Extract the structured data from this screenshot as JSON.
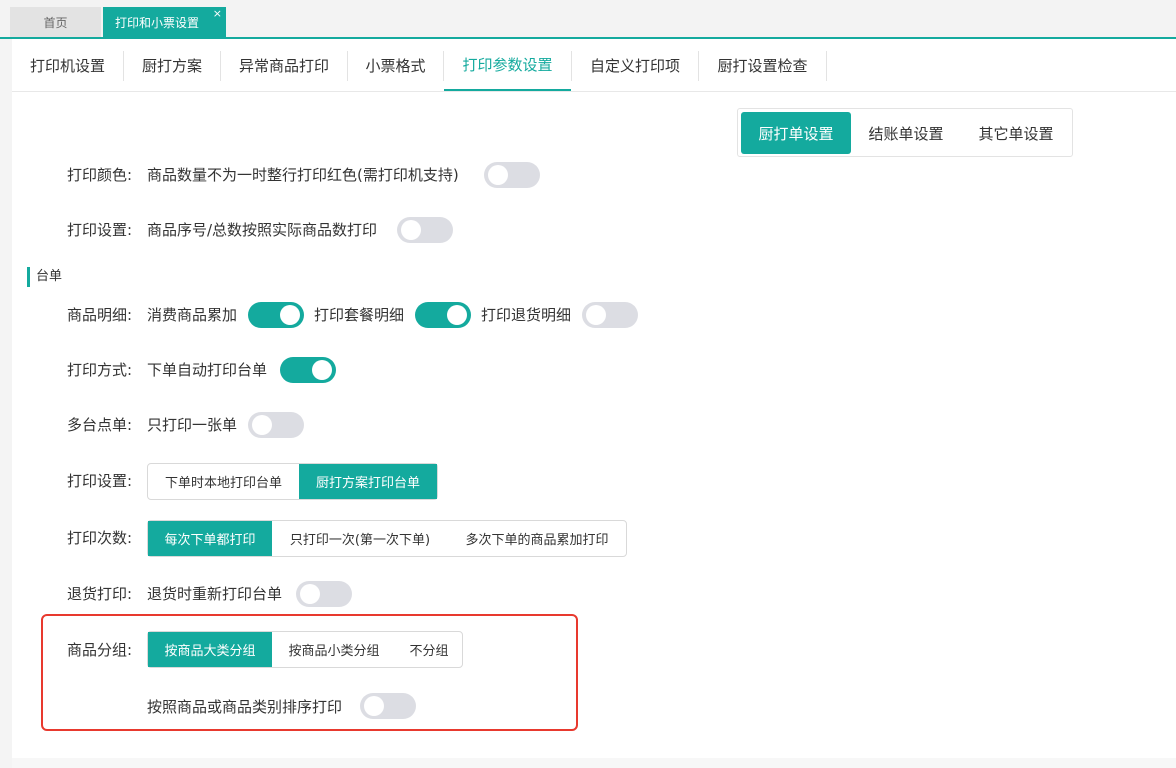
{
  "tabs": {
    "home": "首页",
    "active": "打印和小票设置",
    "close": "×"
  },
  "subnav": [
    "打印机设置",
    "厨打方案",
    "异常商品打印",
    "小票格式",
    "打印参数设置",
    "自定义打印项",
    "厨打设置检查"
  ],
  "subnav_active_index": 4,
  "order_types": {
    "items": [
      "厨打单设置",
      "结账单设置",
      "其它单设置"
    ],
    "active_index": 0
  },
  "settings": {
    "color_label": "打印颜色:",
    "color_option": "商品数量不为一时整行打印红色(需打印机支持)",
    "color_on": false,
    "print_label": "打印设置:",
    "print_option": "商品序号/总数按照实际商品数打印",
    "print_on": false
  },
  "section": {
    "title": "台单"
  },
  "table_bill": {
    "detail_label": "商品明细:",
    "detail_opt1": "消费商品累加",
    "detail_opt1_on": true,
    "detail_opt2": "打印套餐明细",
    "detail_opt2_on": true,
    "detail_opt3": "打印退货明细",
    "detail_opt3_on": false,
    "mode_label": "打印方式:",
    "mode_option": "下单自动打印台单",
    "mode_on": true,
    "multi_label": "多台点单:",
    "multi_option": "只打印一张单",
    "multi_on": false,
    "setting_label": "打印设置:",
    "setting_options": [
      "下单时本地打印台单",
      "厨打方案打印台单"
    ],
    "setting_active": 1,
    "count_label": "打印次数:",
    "count_options": [
      "每次下单都打印",
      "只打印一次(第一次下单)",
      "多次下单的商品累加打印"
    ],
    "count_active": 0,
    "return_label": "退货打印:",
    "return_option": "退货时重新打印台单",
    "return_on": false,
    "group_label": "商品分组:",
    "group_options": [
      "按商品大类分组",
      "按商品小类分组",
      "不分组"
    ],
    "group_active": 0,
    "sort_option": "按照商品或商品类别排序打印",
    "sort_on": false
  },
  "colors": {
    "accent": "#14aa9e",
    "toggle_off": "#dcdde3",
    "highlight": "#e8392e"
  }
}
